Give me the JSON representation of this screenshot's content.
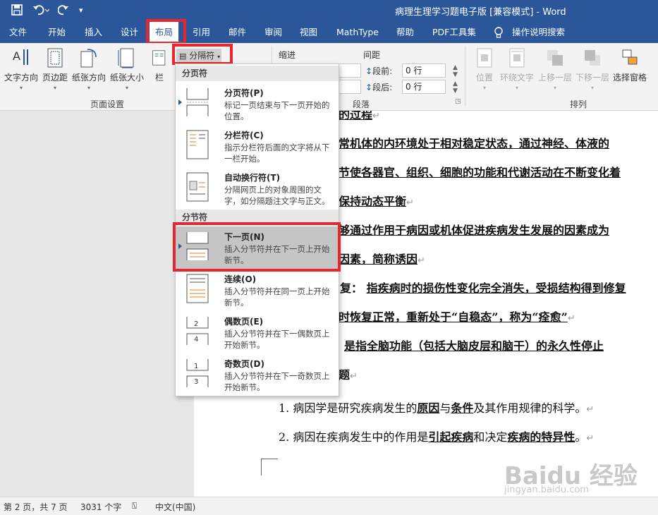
{
  "window": {
    "title": "病理生理学习题电子版 [兼容模式]  -  Word"
  },
  "tabs": [
    "文件",
    "开始",
    "插入",
    "设计",
    "布局",
    "引用",
    "邮件",
    "审阅",
    "视图",
    "MathType",
    "帮助",
    "PDF工具集",
    "操作说明搜索"
  ],
  "ribbon": {
    "page_setup": {
      "buttons": [
        "文字方向",
        "页边距",
        "纸张方向",
        "纸张大小",
        "栏"
      ],
      "group_label": "页面设置",
      "breaks_button": "分隔符"
    },
    "paragraph": {
      "indent_label": "缩进",
      "spacing_label": "间距",
      "before_label": "段前:",
      "before_value": "0 行",
      "after_label": "段后:",
      "after_value": "0 行",
      "group_label": "段落"
    },
    "arrange": {
      "buttons": [
        "位置",
        "环绕文字",
        "上移一层",
        "下移一层",
        "选择窗格"
      ],
      "group_label": "排列"
    }
  },
  "breaks_menu": {
    "section_page": "分页符",
    "section_section": "分节符",
    "items": [
      {
        "title": "分页符(P)",
        "desc": "标记一页结束与下一页开始的位置。"
      },
      {
        "title": "分栏符(C)",
        "desc": "指示分栏符后面的文字将从下一栏开始。"
      },
      {
        "title": "自动换行符(T)",
        "desc": "分隔网页上的对象周围的文字，如分隔题注文字与正文。"
      },
      {
        "title": "下一页(N)",
        "desc": "插入分节符并在下一页上开始新节。"
      },
      {
        "title": "连续(O)",
        "desc": "插入分节符并在同一页上开始新节。"
      },
      {
        "title": "偶数页(E)",
        "desc": "插入分节符并在下一偶数页上开始新节。"
      },
      {
        "title": "奇数页(D)",
        "desc": "插入分节符并在下一奇数页上开始新节。"
      }
    ]
  },
  "document": {
    "lines": [
      {
        "text": "的过程"
      },
      {
        "text": "常机体的内环境处于相对稳定状态，通过神经、体液的"
      },
      {
        "text": "节使各器官、组织、细胞的功能和代谢活动在不断变化着"
      },
      {
        "text": "保持动态平衡"
      },
      {
        "text": "够通过作用于病因或机体促进疾病发生发展的因素成为"
      },
      {
        "text": "因素，简称诱因"
      },
      {
        "pre": "复：",
        "text": "指疾病时的损伤性变化完全消失，受损结构得到修复"
      },
      {
        "text": "时恢复正常，重新处于“自稳态”，称为“痊愈”"
      },
      {
        "text": "是指全脑功能（包括大脑皮层和脑干）的永久性停止"
      },
      {
        "text": "题"
      },
      {
        "plain": [
          "1. 病因学是研究疾病发生的",
          "原因",
          "与",
          "条件",
          "及其作用规律的科学。"
        ]
      },
      {
        "plain": [
          "2. 病因在疾病发生中的作用是",
          "引起疾病",
          "和决定",
          "疾病的特异性",
          "。"
        ]
      }
    ]
  },
  "watermark": {
    "main": "Baidu 经验",
    "sub": "jingyan.baidu.com"
  },
  "status": {
    "page": "第 2 页，共 7 页",
    "words": "3031 个字",
    "language": "中文(中国)"
  }
}
